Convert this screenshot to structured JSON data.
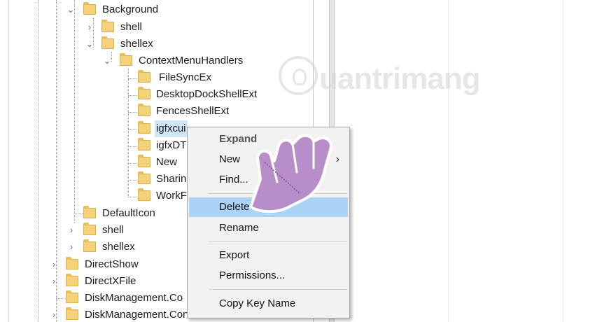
{
  "tree": {
    "items": [
      {
        "label": "Background",
        "expander": "down",
        "level": 4
      },
      {
        "label": "shell",
        "expander": "right",
        "level": 5
      },
      {
        "label": "shellex",
        "expander": "down",
        "level": 5
      },
      {
        "label": "ContextMenuHandlers",
        "expander": "down",
        "level": 6
      },
      {
        "label": "FileSyncEx",
        "expander": "none",
        "level": 7
      },
      {
        "label": "DesktopDockShellExt",
        "expander": "none",
        "level": 7
      },
      {
        "label": "FencesShellExt",
        "expander": "none",
        "level": 7
      },
      {
        "label": "igfxcui",
        "expander": "none",
        "level": 7,
        "selected": true
      },
      {
        "label": "igfxDT",
        "expander": "none",
        "level": 7
      },
      {
        "label": "New",
        "expander": "none",
        "level": 7
      },
      {
        "label": "Sharin",
        "expander": "none",
        "level": 7
      },
      {
        "label": "WorkF",
        "expander": "none",
        "level": 7
      },
      {
        "label": "DefaultIcon",
        "expander": "none",
        "level": 4
      },
      {
        "label": "shell",
        "expander": "right",
        "level": 4
      },
      {
        "label": "shellex",
        "expander": "right",
        "level": 4
      },
      {
        "label": "DirectShow",
        "expander": "right",
        "level": 3
      },
      {
        "label": "DirectXFile",
        "expander": "right",
        "level": 3
      },
      {
        "label": "DiskManagement.Co",
        "expander": "none",
        "level": 3
      },
      {
        "label": "DiskManagement.Control",
        "expander": "right",
        "level": 3
      }
    ]
  },
  "context_menu": {
    "expand": "Expand",
    "new": "New",
    "new_arrow": "›",
    "find": "Find...",
    "delete": "Delete",
    "rename": "Rename",
    "export": "Export",
    "permissions": "Permissions...",
    "copy_key_name": "Copy Key Name"
  },
  "watermark": {
    "text": "uantrimang"
  },
  "colors": {
    "folder": "#f5d27a",
    "menu_highlight": "#a9d2f5",
    "selection": "#cfe6f7",
    "hand_fill": "#b88ec9"
  },
  "icons": {
    "folder": "folder-icon",
    "expand_down": "chevron-down-icon",
    "expand_right": "chevron-right-icon",
    "submenu": "submenu-arrow-icon",
    "pointer": "pointing-hand-icon"
  }
}
